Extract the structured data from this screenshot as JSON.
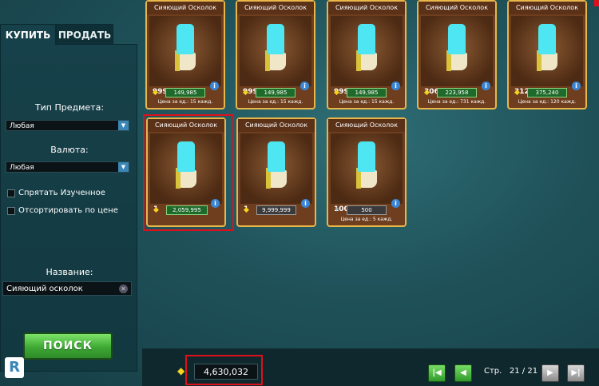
{
  "tabs": {
    "buy": "КУПИТЬ",
    "sell": "ПРОДАТЬ"
  },
  "filters": {
    "item_type_label": "Тип Предмета:",
    "item_type_value": "Любая",
    "currency_label": "Валюта:",
    "currency_value": "Любая",
    "hide_learned": "Спрятать Изученное",
    "sort_by_price": "Отсортировать по цене",
    "name_label": "Название:",
    "name_value": "Сияющий осколок",
    "search_button": "ПОИСК"
  },
  "listings": [
    {
      "title": "Сияющий Осколок",
      "qty": "9999",
      "price": "149,985",
      "unit": "Цена за ед.: 15 кажд."
    },
    {
      "title": "Сияющий Осколок",
      "qty": "9999",
      "price": "149,985",
      "unit": "Цена за ед.: 15 кажд."
    },
    {
      "title": "Сияющий Осколок",
      "qty": "9999",
      "price": "149,985",
      "unit": "Цена за ед.: 15 кажд."
    },
    {
      "title": "Сияющий Осколок",
      "qty": "306",
      "price": "223,958",
      "unit": "Цена за ед.: 731 кажд."
    },
    {
      "title": "Сияющий Осколок",
      "qty": "3127",
      "price": "375,240",
      "unit": "Цена за ед.: 120 кажд."
    },
    {
      "title": "Сияющий Осколок",
      "qty": "1",
      "price": "2,059,995",
      "unit": ""
    },
    {
      "title": "Сияющий Осколок",
      "qty": "1",
      "price": "9,999,999",
      "unit": ""
    },
    {
      "title": "Сияющий Осколок",
      "qty": "100",
      "price": "500",
      "unit": "Цена за ед.: 5 кажд."
    }
  ],
  "footer": {
    "balance": "4,630,032",
    "page_label": "Стр.",
    "page_value": "21 / 21"
  },
  "icons": {
    "coin": "coin-icon",
    "info": "info-icon",
    "first": "first-page-icon",
    "prev": "prev-page-icon",
    "next": "next-page-icon",
    "last": "last-page-icon"
  },
  "colors": {
    "accent_green": "#3ea934",
    "highlight_red": "#e0101a",
    "card_border": "#e9b64a"
  }
}
